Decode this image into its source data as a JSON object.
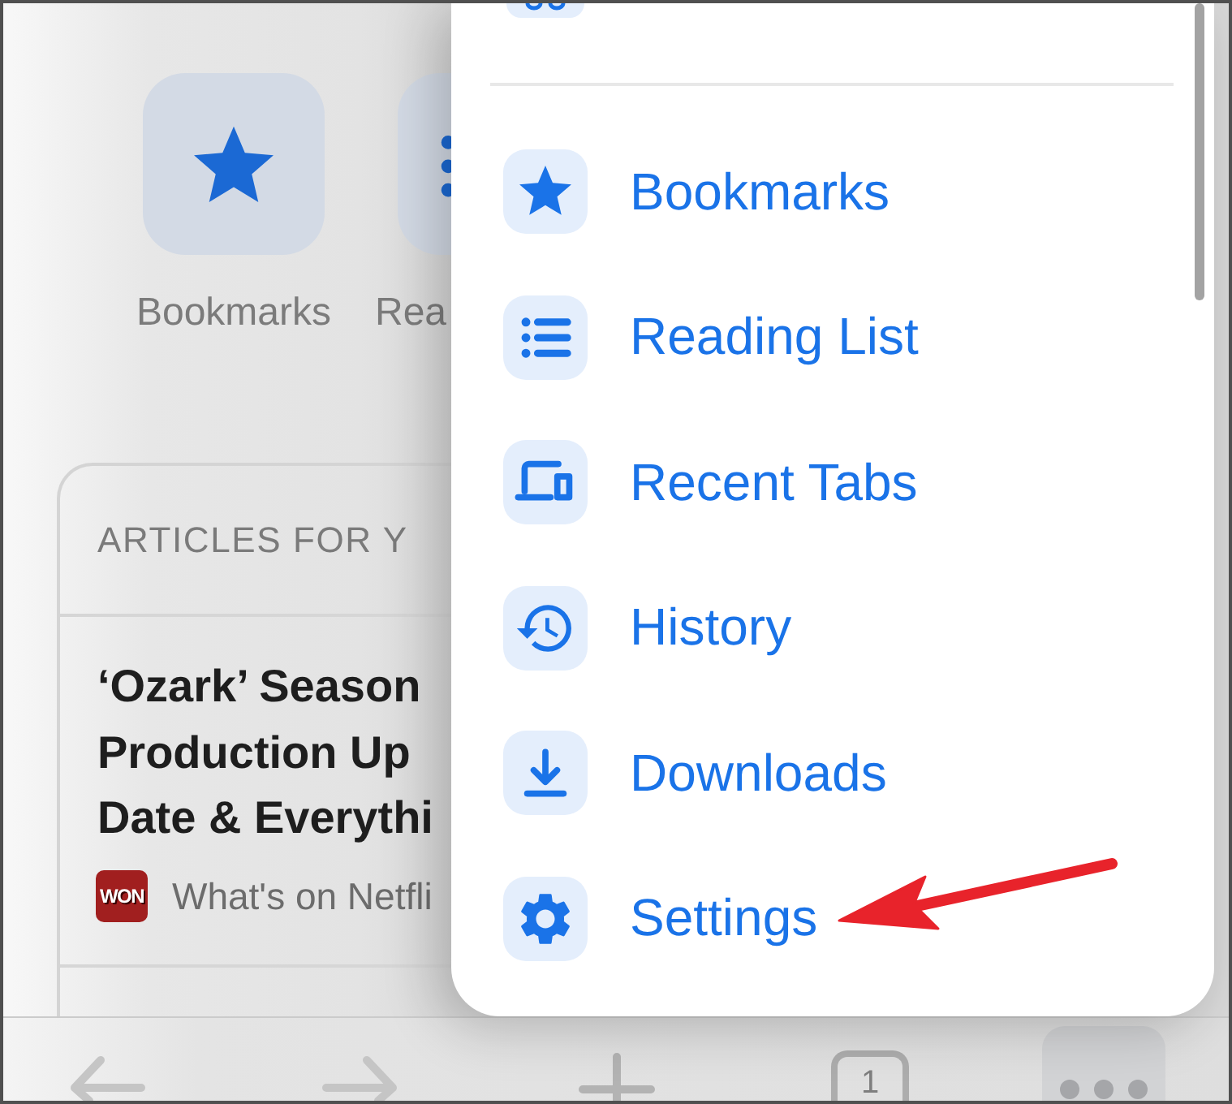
{
  "page": {
    "shortcuts": [
      {
        "label": "Bookmarks",
        "kind": "bookmarks"
      },
      {
        "label": "Rea",
        "kind": "reading_list"
      }
    ],
    "articles": {
      "heading": "ARTICLES FOR Y",
      "items": [
        {
          "title_lines": [
            "‘Ozark’ Season",
            "Production Up",
            "Date & Everythi"
          ],
          "source_logo": "WON",
          "source": "What's on Netfli"
        }
      ]
    }
  },
  "menu": {
    "items": [
      {
        "label": "Bookmarks",
        "kind": "bookmarks"
      },
      {
        "label": "Reading List",
        "kind": "reading_list"
      },
      {
        "label": "Recent Tabs",
        "kind": "recent_tabs"
      },
      {
        "label": "History",
        "kind": "history"
      },
      {
        "label": "Downloads",
        "kind": "downloads"
      },
      {
        "label": "Settings",
        "kind": "settings"
      }
    ]
  },
  "toolbar": {
    "tab_count": "1"
  }
}
